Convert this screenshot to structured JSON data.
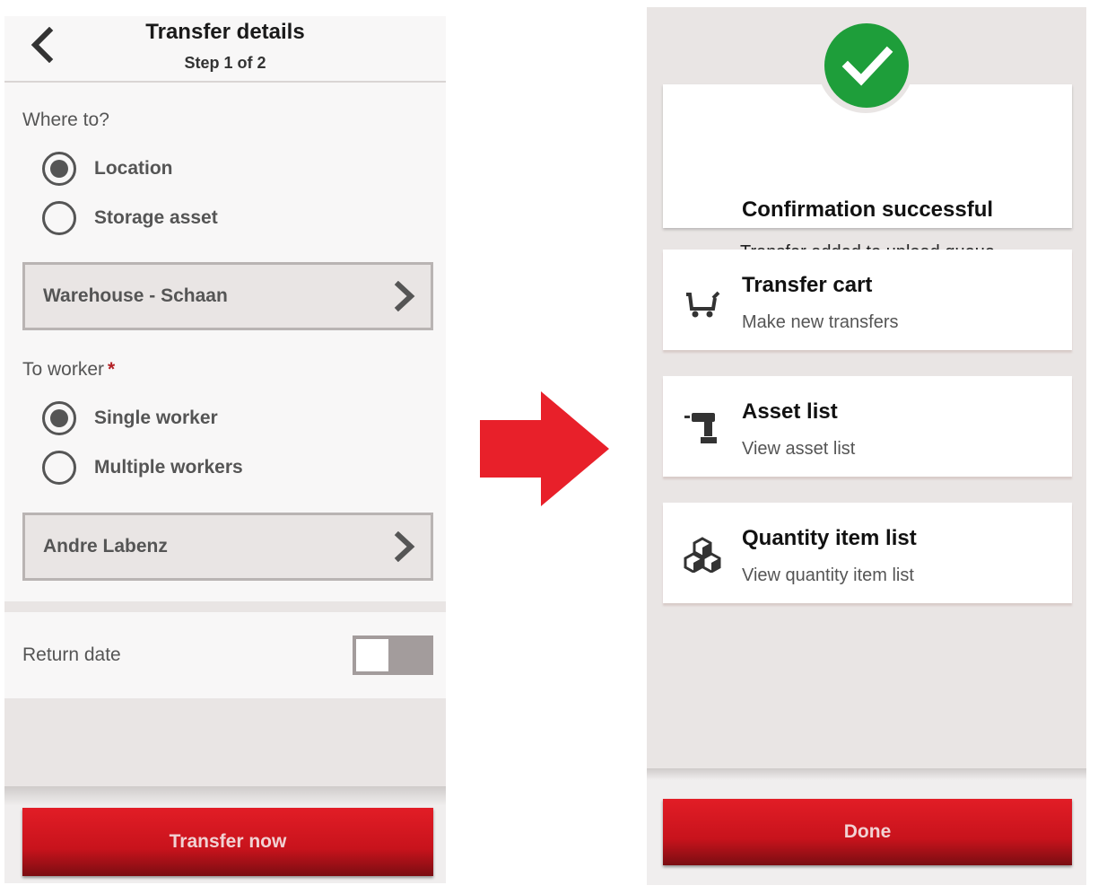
{
  "left": {
    "header": {
      "title": "Transfer details",
      "step": "Step 1 of 2"
    },
    "where_to": {
      "label": "Where to?",
      "options": [
        {
          "label": "Location",
          "selected": true
        },
        {
          "label": "Storage asset",
          "selected": false
        }
      ],
      "selected_value": "Warehouse - Schaan"
    },
    "to_worker": {
      "label": "To worker",
      "required_mark": "*",
      "options": [
        {
          "label": "Single worker",
          "selected": true
        },
        {
          "label": "Multiple workers",
          "selected": false
        }
      ],
      "selected_value": "Andre Labenz"
    },
    "return_date": {
      "label": "Return date",
      "enabled": false
    },
    "footer": {
      "button_label": "Transfer now"
    }
  },
  "right": {
    "confirmation": {
      "title": "Confirmation successful",
      "subtitle": "Transfer added to upload queue"
    },
    "actions": [
      {
        "title": "Transfer cart",
        "subtitle": "Make new transfers",
        "icon": "cart-icon"
      },
      {
        "title": "Asset list",
        "subtitle": "View asset list",
        "icon": "drill-icon"
      },
      {
        "title": "Quantity item list",
        "subtitle": "View quantity item list",
        "icon": "boxes-icon"
      }
    ],
    "footer": {
      "button_label": "Done"
    }
  },
  "colors": {
    "primary_red": "#c8131c",
    "success_green": "#1e9e3a",
    "arrow_red": "#e8202a",
    "panel_grey": "#e9e5e4"
  }
}
